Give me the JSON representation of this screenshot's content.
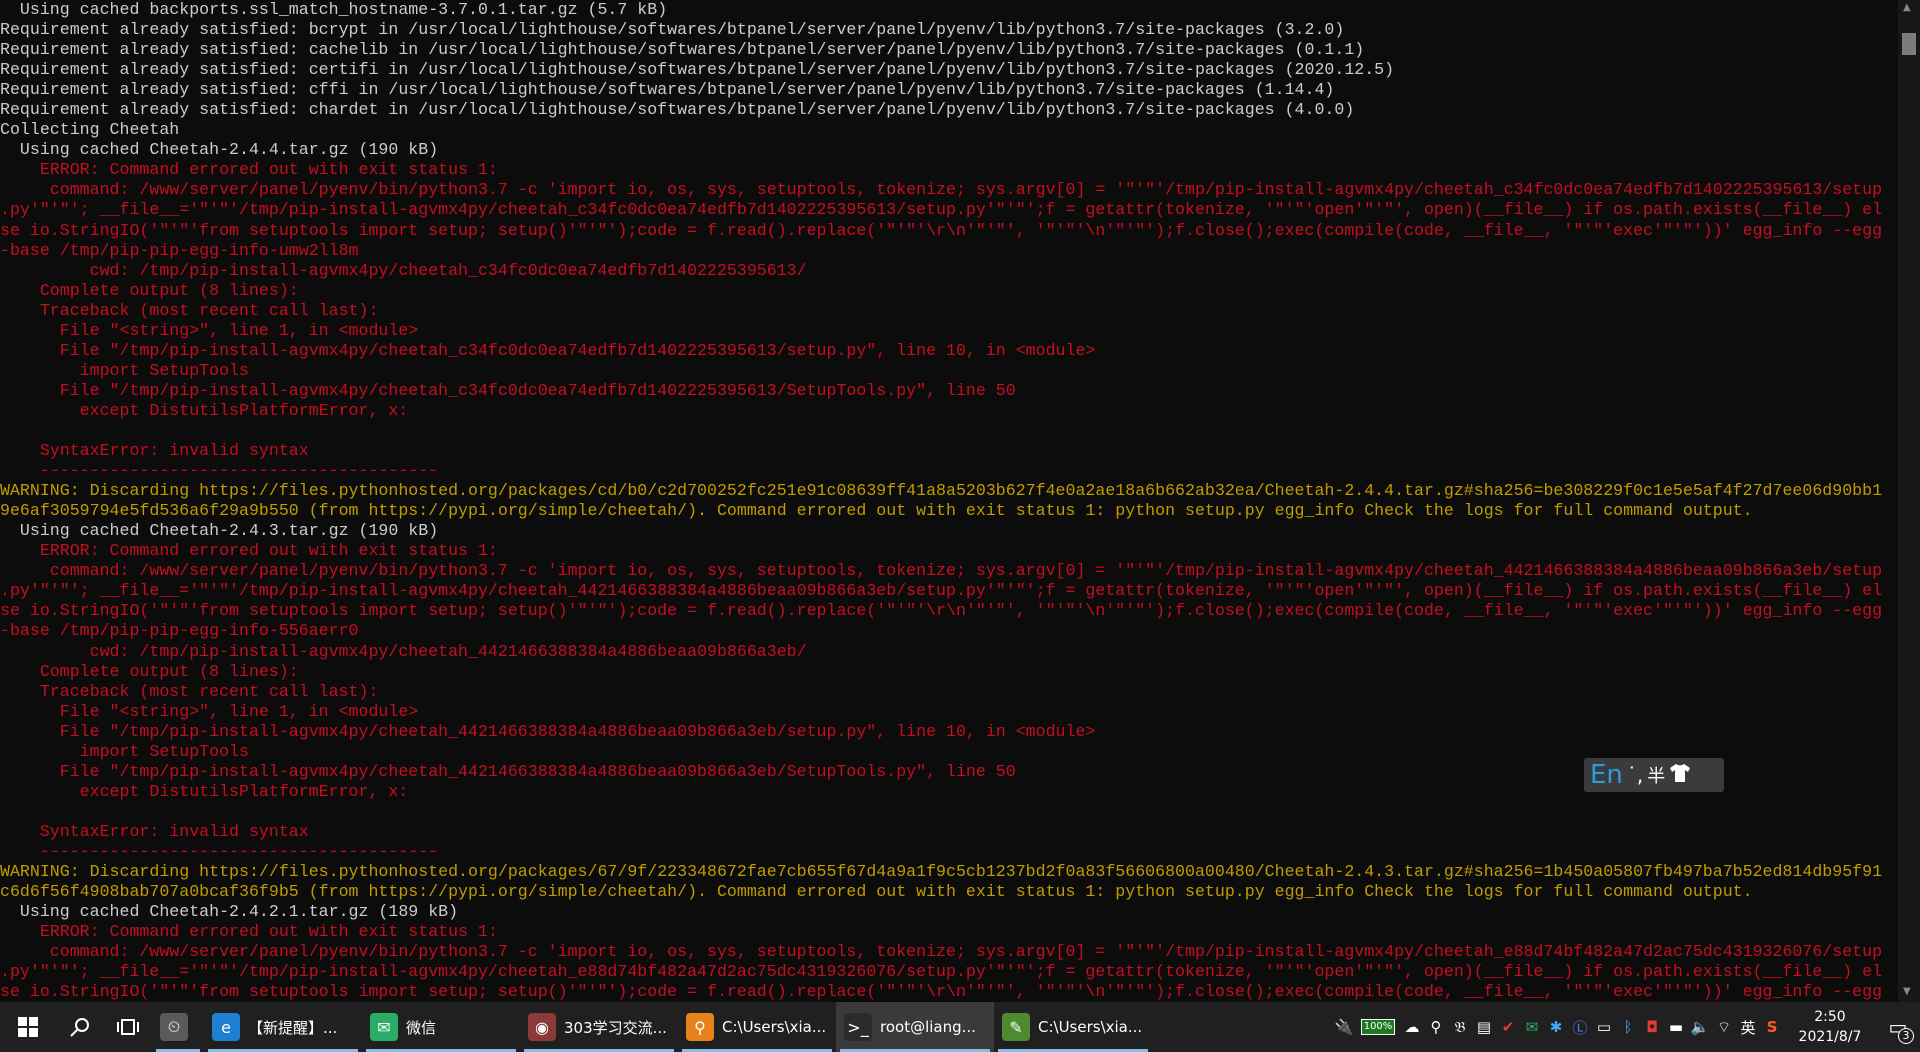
{
  "terminal": {
    "lines": [
      {
        "text": "  Using cached backports.ssl_match_hostname-3.7.0.1.tar.gz (5.7 kB)",
        "color": "white"
      },
      {
        "text": "Requirement already satisfied: bcrypt in /usr/local/lighthouse/softwares/btpanel/server/panel/pyenv/lib/python3.7/site-packages (3.2.0)",
        "color": "white"
      },
      {
        "text": "Requirement already satisfied: cachelib in /usr/local/lighthouse/softwares/btpanel/server/panel/pyenv/lib/python3.7/site-packages (0.1.1)",
        "color": "white"
      },
      {
        "text": "Requirement already satisfied: certifi in /usr/local/lighthouse/softwares/btpanel/server/panel/pyenv/lib/python3.7/site-packages (2020.12.5)",
        "color": "white"
      },
      {
        "text": "Requirement already satisfied: cffi in /usr/local/lighthouse/softwares/btpanel/server/panel/pyenv/lib/python3.7/site-packages (1.14.4)",
        "color": "white"
      },
      {
        "text": "Requirement already satisfied: chardet in /usr/local/lighthouse/softwares/btpanel/server/panel/pyenv/lib/python3.7/site-packages (4.0.0)",
        "color": "white"
      },
      {
        "text": "Collecting Cheetah",
        "color": "white"
      },
      {
        "text": "  Using cached Cheetah-2.4.4.tar.gz (190 kB)",
        "color": "white"
      },
      {
        "text": "    ERROR: Command errored out with exit status 1:",
        "color": "red"
      },
      {
        "text": "     command: /www/server/panel/pyenv/bin/python3.7 -c 'import io, os, sys, setuptools, tokenize; sys.argv[0] = '\"'\"'/tmp/pip-install-agvmx4py/cheetah_c34fc0dc0ea74edfb7d1402225395613/setup",
        "color": "red"
      },
      {
        "text": ".py'\"'\"'; __file__='\"'\"'/tmp/pip-install-agvmx4py/cheetah_c34fc0dc0ea74edfb7d1402225395613/setup.py'\"'\"';f = getattr(tokenize, '\"'\"'open'\"'\"', open)(__file__) if os.path.exists(__file__) el",
        "color": "red"
      },
      {
        "text": "se io.StringIO('\"'\"'from setuptools import setup; setup()'\"'\"');code = f.read().replace('\"'\"'\\r\\n'\"'\"', '\"'\"'\\n'\"'\"');f.close();exec(compile(code, __file__, '\"'\"'exec'\"'\"'))' egg_info --egg",
        "color": "red"
      },
      {
        "text": "-base /tmp/pip-pip-egg-info-umw2ll8m",
        "color": "red"
      },
      {
        "text": "         cwd: /tmp/pip-install-agvmx4py/cheetah_c34fc0dc0ea74edfb7d1402225395613/",
        "color": "red"
      },
      {
        "text": "    Complete output (8 lines):",
        "color": "red"
      },
      {
        "text": "    Traceback (most recent call last):",
        "color": "red"
      },
      {
        "text": "      File \"<string>\", line 1, in <module>",
        "color": "red"
      },
      {
        "text": "      File \"/tmp/pip-install-agvmx4py/cheetah_c34fc0dc0ea74edfb7d1402225395613/setup.py\", line 10, in <module>",
        "color": "red"
      },
      {
        "text": "        import SetupTools",
        "color": "red"
      },
      {
        "text": "      File \"/tmp/pip-install-agvmx4py/cheetah_c34fc0dc0ea74edfb7d1402225395613/SetupTools.py\", line 50",
        "color": "red"
      },
      {
        "text": "        except DistutilsPlatformError, x:",
        "color": "red"
      },
      {
        "text": "",
        "color": "red"
      },
      {
        "text": "    SyntaxError: invalid syntax",
        "color": "red"
      },
      {
        "text": "    ----------------------------------------",
        "color": "red"
      },
      {
        "text": "WARNING: Discarding https://files.pythonhosted.org/packages/cd/b0/c2d700252fc251e91c08639ff41a8a5203b627f4e0a2ae18a6b662ab32ea/Cheetah-2.4.4.tar.gz#sha256=be308229f0c1e5e5af4f27d7ee06d90bb1",
        "color": "yellow"
      },
      {
        "text": "9e6af3059794e5fd536a6f29a9b550 (from https://pypi.org/simple/cheetah/). Command errored out with exit status 1: python setup.py egg_info Check the logs for full command output.",
        "color": "yellow"
      },
      {
        "text": "  Using cached Cheetah-2.4.3.tar.gz (190 kB)",
        "color": "white"
      },
      {
        "text": "    ERROR: Command errored out with exit status 1:",
        "color": "red"
      },
      {
        "text": "     command: /www/server/panel/pyenv/bin/python3.7 -c 'import io, os, sys, setuptools, tokenize; sys.argv[0] = '\"'\"'/tmp/pip-install-agvmx4py/cheetah_4421466388384a4886beaa09b866a3eb/setup",
        "color": "red"
      },
      {
        "text": ".py'\"'\"'; __file__='\"'\"'/tmp/pip-install-agvmx4py/cheetah_4421466388384a4886beaa09b866a3eb/setup.py'\"'\"';f = getattr(tokenize, '\"'\"'open'\"'\"', open)(__file__) if os.path.exists(__file__) el",
        "color": "red"
      },
      {
        "text": "se io.StringIO('\"'\"'from setuptools import setup; setup()'\"'\"');code = f.read().replace('\"'\"'\\r\\n'\"'\"', '\"'\"'\\n'\"'\"');f.close();exec(compile(code, __file__, '\"'\"'exec'\"'\"'))' egg_info --egg",
        "color": "red"
      },
      {
        "text": "-base /tmp/pip-pip-egg-info-556aerr0",
        "color": "red"
      },
      {
        "text": "         cwd: /tmp/pip-install-agvmx4py/cheetah_4421466388384a4886beaa09b866a3eb/",
        "color": "red"
      },
      {
        "text": "    Complete output (8 lines):",
        "color": "red"
      },
      {
        "text": "    Traceback (most recent call last):",
        "color": "red"
      },
      {
        "text": "      File \"<string>\", line 1, in <module>",
        "color": "red"
      },
      {
        "text": "      File \"/tmp/pip-install-agvmx4py/cheetah_4421466388384a4886beaa09b866a3eb/setup.py\", line 10, in <module>",
        "color": "red"
      },
      {
        "text": "        import SetupTools",
        "color": "red"
      },
      {
        "text": "      File \"/tmp/pip-install-agvmx4py/cheetah_4421466388384a4886beaa09b866a3eb/SetupTools.py\", line 50",
        "color": "red"
      },
      {
        "text": "        except DistutilsPlatformError, x:",
        "color": "red"
      },
      {
        "text": "",
        "color": "red"
      },
      {
        "text": "    SyntaxError: invalid syntax",
        "color": "red"
      },
      {
        "text": "    ----------------------------------------",
        "color": "red"
      },
      {
        "text": "WARNING: Discarding https://files.pythonhosted.org/packages/67/9f/223348672fae7cb655f67d4a9a1f9c5cb1237bd2f0a83f56606800a00480/Cheetah-2.4.3.tar.gz#sha256=1b450a05807fb497ba7b52ed814db95f91",
        "color": "yellow"
      },
      {
        "text": "c6d6f56f4908bab707a0bcaf36f9b5 (from https://pypi.org/simple/cheetah/). Command errored out with exit status 1: python setup.py egg_info Check the logs for full command output.",
        "color": "yellow"
      },
      {
        "text": "  Using cached Cheetah-2.4.2.1.tar.gz (189 kB)",
        "color": "white"
      },
      {
        "text": "    ERROR: Command errored out with exit status 1:",
        "color": "red"
      },
      {
        "text": "     command: /www/server/panel/pyenv/bin/python3.7 -c 'import io, os, sys, setuptools, tokenize; sys.argv[0] = '\"'\"'/tmp/pip-install-agvmx4py/cheetah_e88d74bf482a47d2ac75dc4319326076/setup",
        "color": "red"
      },
      {
        "text": ".py'\"'\"'; __file__='\"'\"'/tmp/pip-install-agvmx4py/cheetah_e88d74bf482a47d2ac75dc4319326076/setup.py'\"'\"';f = getattr(tokenize, '\"'\"'open'\"'\"', open)(__file__) if os.path.exists(__file__) el",
        "color": "red"
      },
      {
        "text": "se io.StringIO('\"'\"'from setuptools import setup; setup()'\"'\"');code = f.read().replace('\"'\"'\\r\\n'\"'\"', '\"'\"'\\n'\"'\"');f.close();exec(compile(code, __file__, '\"'\"'exec'\"'\"'))' egg_info --egg",
        "color": "red"
      }
    ]
  },
  "ime": {
    "lang": "En",
    "punct": "˙,",
    "half": "半",
    "skin_icon": "tshirt-icon"
  },
  "taskbar": {
    "start_icon": "windows-logo-icon",
    "search_icon": "search-icon",
    "taskview_icon": "task-view-icon",
    "apps": [
      {
        "label": "",
        "icon": "clock-app-icon",
        "color": "#5a5a5a",
        "glyph": "⏲"
      },
      {
        "label": "【新提醒】...",
        "icon": "edge-browser-icon",
        "color": "#1f7fd0",
        "glyph": "e"
      },
      {
        "label": "微信",
        "icon": "wechat-icon",
        "color": "#2aae67",
        "glyph": "✉"
      },
      {
        "label": "303学习交流...",
        "icon": "chat-group-icon",
        "color": "#8b3a3a",
        "glyph": "◉"
      },
      {
        "label": "C:\\Users\\xia...",
        "icon": "search-everything-icon",
        "color": "#e8821a",
        "glyph": "⚲"
      },
      {
        "label": "root@liang...",
        "icon": "terminal-icon",
        "color": "#2b2b2b",
        "glyph": ">_"
      },
      {
        "label": "C:\\Users\\xia...",
        "icon": "notepad-icon",
        "color": "#4c8c2f",
        "glyph": "✎"
      }
    ],
    "battery": "100%",
    "ime_lang": "英",
    "time": "2:50",
    "date": "2021/8/7",
    "notification_count": "3"
  },
  "colors": {
    "background": "#0c0c0c",
    "white": "#cccccc",
    "red": "#c50f1f",
    "yellow": "#c19c00",
    "taskbar": "#202020"
  }
}
